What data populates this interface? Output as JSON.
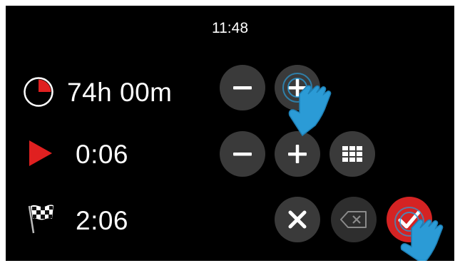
{
  "status_bar": {
    "time": "11:48"
  },
  "rows": [
    {
      "id": "total-time",
      "icon": "pie-timer-icon",
      "value": "74h 00m",
      "controls": [
        "decrement-button",
        "increment-button"
      ]
    },
    {
      "id": "elapsed-time",
      "icon": "play-icon",
      "value": "0:06",
      "controls": [
        "decrement-button",
        "increment-button",
        "keypad-button"
      ]
    },
    {
      "id": "finish-time",
      "icon": "checkered-flag-icon",
      "value": "2:06",
      "controls": [
        "cancel-button",
        "backspace-button",
        "confirm-button"
      ]
    }
  ],
  "colors": {
    "background": "#000000",
    "button": "#3a3a3a",
    "confirm": "#d42323",
    "accent_red": "#e02020",
    "touch_hand": "#2b9bd6"
  },
  "overlays": [
    "touch-hand-icon",
    "touch-hand-icon"
  ]
}
